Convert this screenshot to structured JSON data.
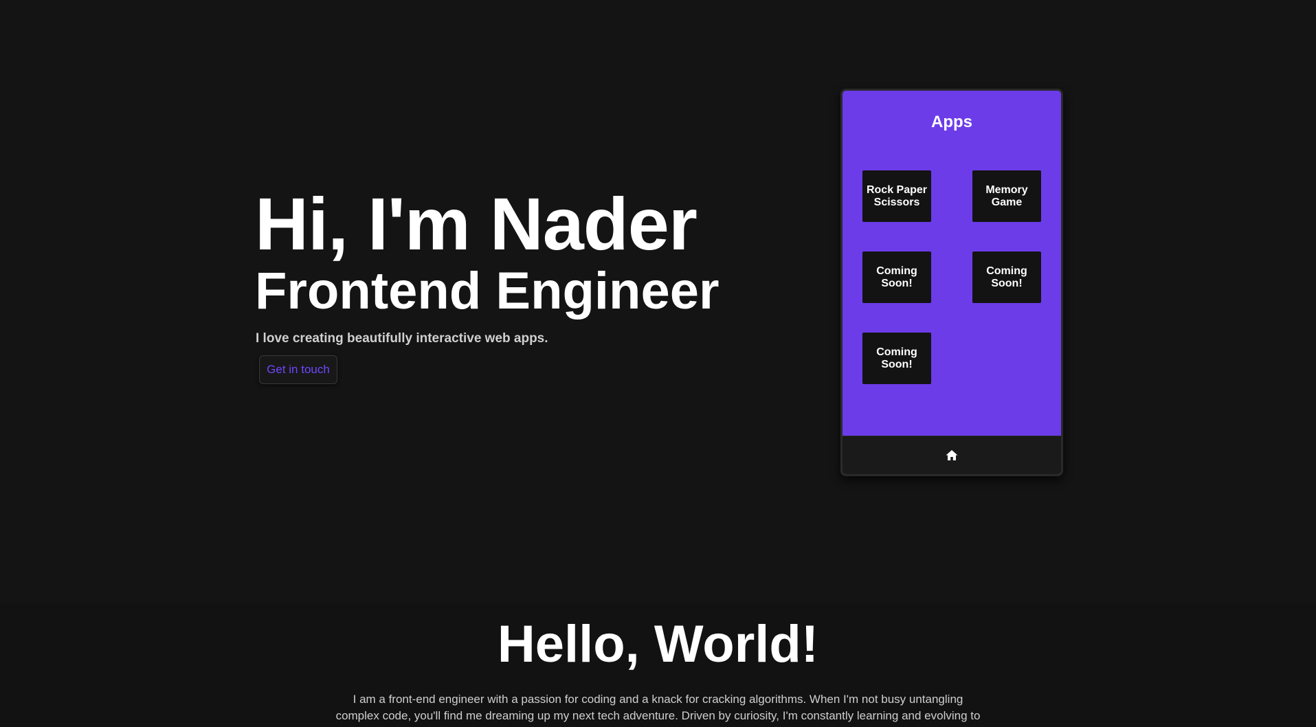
{
  "hero": {
    "title": "Hi, I'm Nader",
    "subtitle": "Frontend Engineer",
    "tagline": "I love creating beautifully interactive web apps.",
    "cta_label": "Get in touch"
  },
  "phone": {
    "title": "Apps",
    "apps": [
      {
        "label": "Rock Paper Scissors"
      },
      {
        "label": "Memory Game"
      },
      {
        "label": "Coming Soon!"
      },
      {
        "label": "Coming Soon!"
      },
      {
        "label": "Coming Soon!"
      }
    ],
    "footer_icon": "home-icon"
  },
  "about": {
    "title": "Hello, World!",
    "text": "I am a front-end engineer with a passion for coding and a knack for cracking algorithms. When I'm not busy untangling complex code, you'll find me dreaming up my next tech adventure. Driven by curiosity, I'm constantly learning and evolving to"
  },
  "colors": {
    "background": "#141414",
    "accent": "#6c3ce9",
    "cta_text": "#6f47ff",
    "tile": "#131313"
  }
}
